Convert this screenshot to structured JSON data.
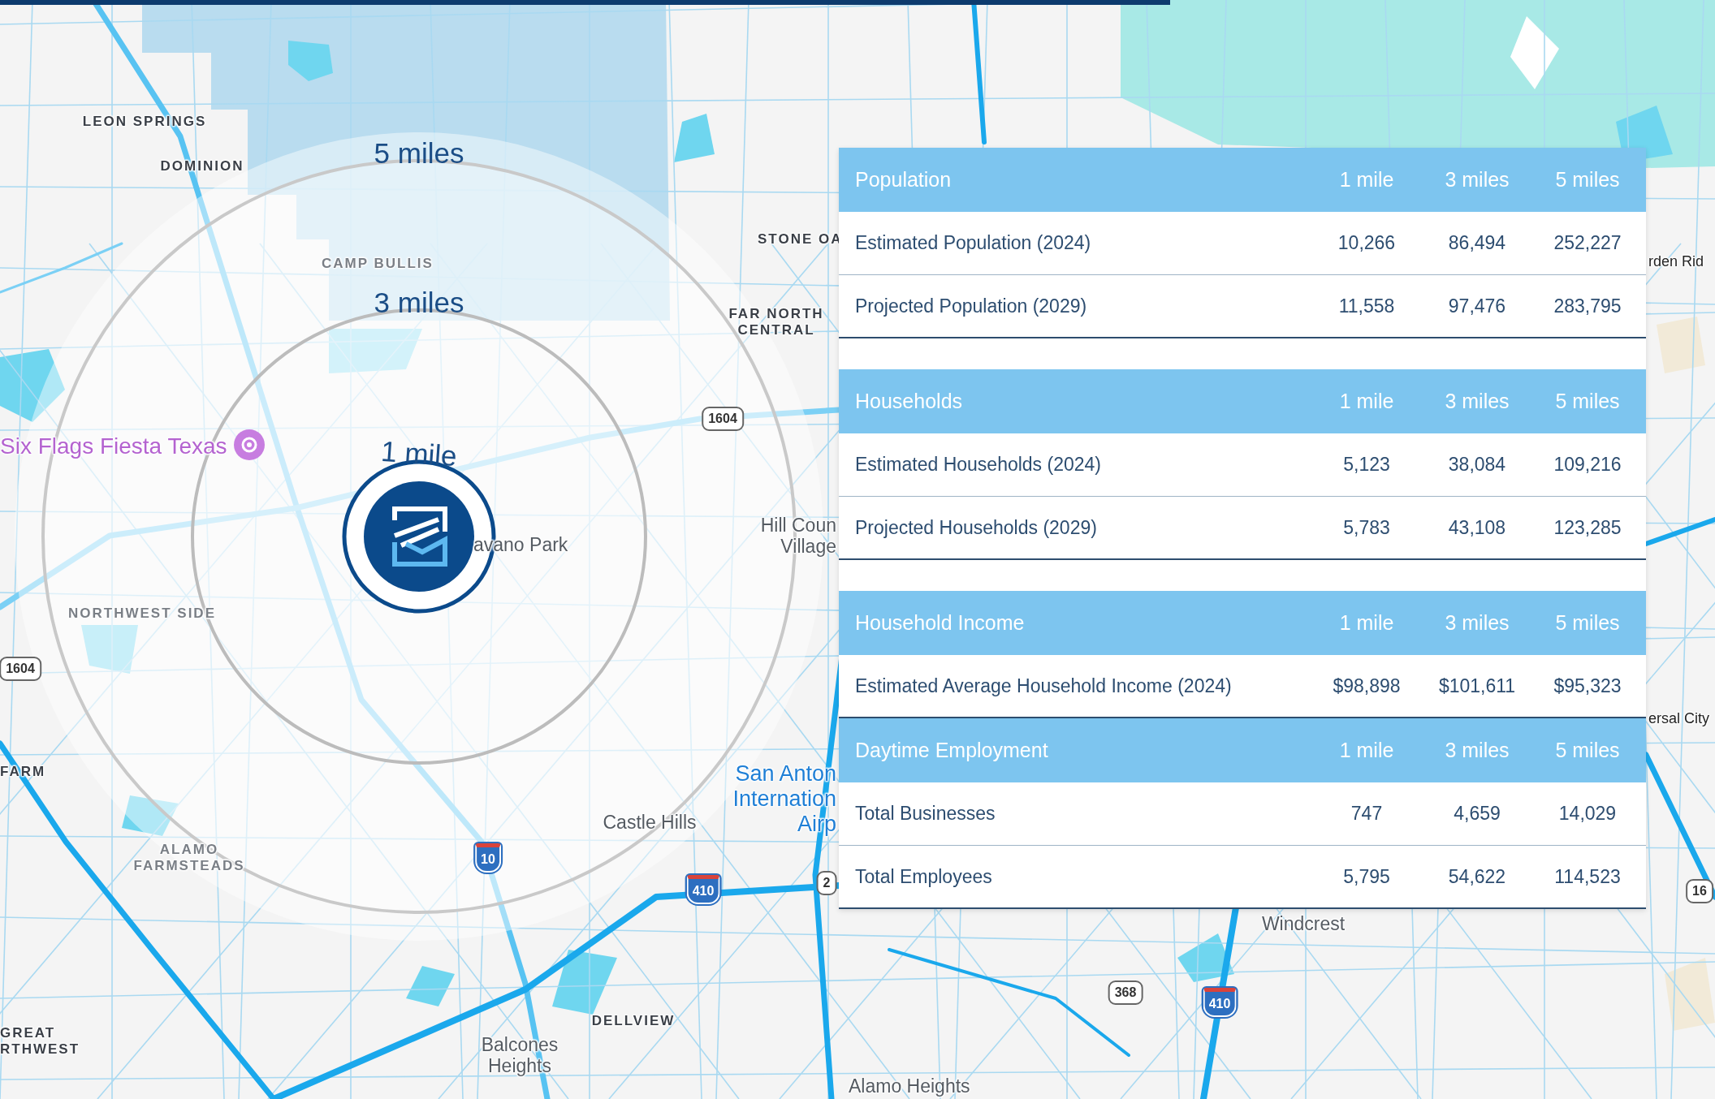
{
  "map": {
    "radius_labels": [
      "5 miles",
      "3 miles",
      "1 mile"
    ],
    "places": [
      {
        "lines": [
          "LEON SPRINGS"
        ],
        "kind": "district"
      },
      {
        "lines": [
          "DOMINION"
        ],
        "kind": "district"
      },
      {
        "lines": [
          "CAMP BULLIS"
        ],
        "kind": "area"
      },
      {
        "lines": [
          "STONE OA"
        ],
        "kind": "district"
      },
      {
        "lines": [
          "FAR NORTH",
          "CENTRAL"
        ],
        "kind": "district"
      },
      {
        "lines": [
          "Six Flags Fiesta Texas"
        ],
        "kind": "poi"
      },
      {
        "lines": [
          "avano Park"
        ],
        "kind": "town"
      },
      {
        "lines": [
          "Hill Coun",
          "Village"
        ],
        "kind": "town"
      },
      {
        "lines": [
          "NORTHWEST SIDE"
        ],
        "kind": "area"
      },
      {
        "lines": [
          "FARM"
        ],
        "kind": "district"
      },
      {
        "lines": [
          "ALAMO",
          "FARMSTEADS"
        ],
        "kind": "area"
      },
      {
        "lines": [
          "Castle Hills"
        ],
        "kind": "town"
      },
      {
        "lines": [
          "San Anton",
          "Internation",
          "Airp"
        ],
        "kind": "airport"
      },
      {
        "lines": [
          "GREAT",
          "RTHWEST"
        ],
        "kind": "district"
      },
      {
        "lines": [
          "Balcones",
          "Heights"
        ],
        "kind": "town"
      },
      {
        "lines": [
          "DELLVIEW"
        ],
        "kind": "district"
      },
      {
        "lines": [
          "Windcrest"
        ],
        "kind": "town"
      },
      {
        "lines": [
          "Alamo Heights"
        ],
        "kind": "town"
      },
      {
        "lines": [
          "rden Rid"
        ],
        "kind": "town"
      },
      {
        "lines": [
          "ersal City"
        ],
        "kind": "town"
      }
    ],
    "shields": [
      {
        "text": "1604",
        "kind": "state"
      },
      {
        "text": "1604",
        "kind": "state"
      },
      {
        "text": "10",
        "kind": "interstate"
      },
      {
        "text": "410",
        "kind": "interstate"
      },
      {
        "text": "2",
        "kind": "state"
      },
      {
        "text": "368",
        "kind": "state"
      },
      {
        "text": "410",
        "kind": "interstate"
      },
      {
        "text": "16",
        "kind": "state"
      }
    ]
  },
  "demographics": {
    "sections": [
      {
        "title": "Population",
        "columns": [
          "1 mile",
          "3 miles",
          "5 miles"
        ],
        "rows": [
          {
            "label": "Estimated Population (2024)",
            "values": [
              "10,266",
              "86,494",
              "252,227"
            ]
          },
          {
            "label": "Projected Population (2029)",
            "values": [
              "11,558",
              "97,476",
              "283,795"
            ]
          }
        ]
      },
      {
        "title": "Households",
        "columns": [
          "1 mile",
          "3 miles",
          "5 miles"
        ],
        "rows": [
          {
            "label": "Estimated Households (2024)",
            "values": [
              "5,123",
              "38,084",
              "109,216"
            ]
          },
          {
            "label": "Projected Households (2029)",
            "values": [
              "5,783",
              "43,108",
              "123,285"
            ]
          }
        ]
      },
      {
        "title": "Household Income",
        "columns": [
          "1 mile",
          "3 miles",
          "5 miles"
        ],
        "rows": [
          {
            "label": "Estimated Average Household Income (2024)",
            "values": [
              "$98,898",
              "$101,611",
              "$95,323"
            ]
          }
        ]
      },
      {
        "title": "Daytime Employment",
        "columns": [
          "1 mile",
          "3 miles",
          "5 miles"
        ],
        "rows": [
          {
            "label": "Total Businesses",
            "values": [
              "747",
              "4,659",
              "14,029"
            ]
          },
          {
            "label": "Total Employees",
            "values": [
              "5,795",
              "54,622",
              "114,523"
            ]
          }
        ]
      }
    ]
  }
}
